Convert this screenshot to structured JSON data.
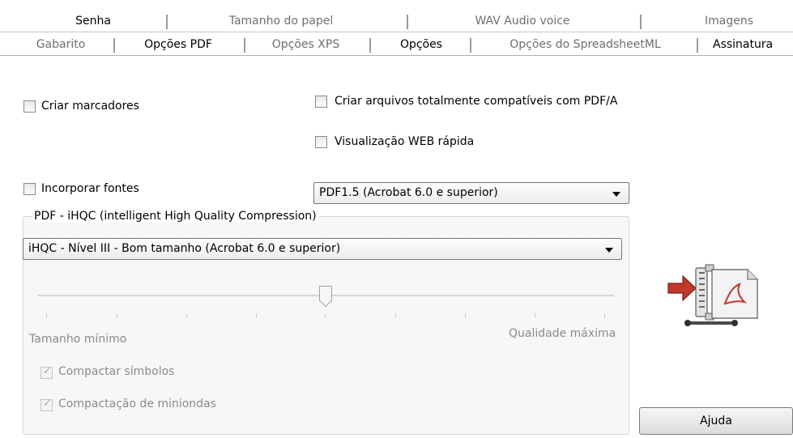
{
  "tabs_row1": [
    {
      "label": "Senha",
      "active": true
    },
    {
      "label": "Tamanho do papel",
      "active": false
    },
    {
      "label": "WAV Audio voice",
      "active": false
    },
    {
      "label": "Imagens",
      "active": false
    }
  ],
  "tabs_row2": [
    {
      "label": "Gabarito",
      "active": false
    },
    {
      "label": "Opções PDF",
      "active": true
    },
    {
      "label": "Opções XPS",
      "active": false
    },
    {
      "label": "Opções",
      "active": true
    },
    {
      "label": "Opções do SpreadsheetML",
      "active": false
    },
    {
      "label": "Assinatura",
      "active": true
    }
  ],
  "options": {
    "create_bookmarks": {
      "label": "Criar marcadores",
      "checked": false
    },
    "pdfa_compliant": {
      "label": "Criar arquivos totalmente compatíveis com PDF/A",
      "checked": false
    },
    "fast_web_view": {
      "label": "Visualização WEB rápida",
      "checked": false
    },
    "embed_fonts": {
      "label": "Incorporar fontes",
      "checked": false
    }
  },
  "pdf_version": {
    "selected": "PDF1.5 (Acrobat 6.0 e superior)"
  },
  "ihqc": {
    "group_title": "PDF - iHQC (intelligent High Quality Compression)",
    "level_selected": "iHQC - Nível III - Bom tamanho (Acrobat 6.0 e superior)",
    "slider": {
      "min_label": "Tamanho mínimo",
      "max_label": "Qualidade máxima",
      "position_fraction": 0.5
    },
    "compress_symbols": {
      "label": "Compactar símbolos",
      "checked": true,
      "enabled": false
    },
    "compress_thumbnails": {
      "label": "Compactação de miniondas",
      "checked": true,
      "enabled": false
    }
  },
  "help_button": {
    "label": "Ajuda"
  },
  "icons": {
    "compress": "pdf-compress-icon"
  }
}
